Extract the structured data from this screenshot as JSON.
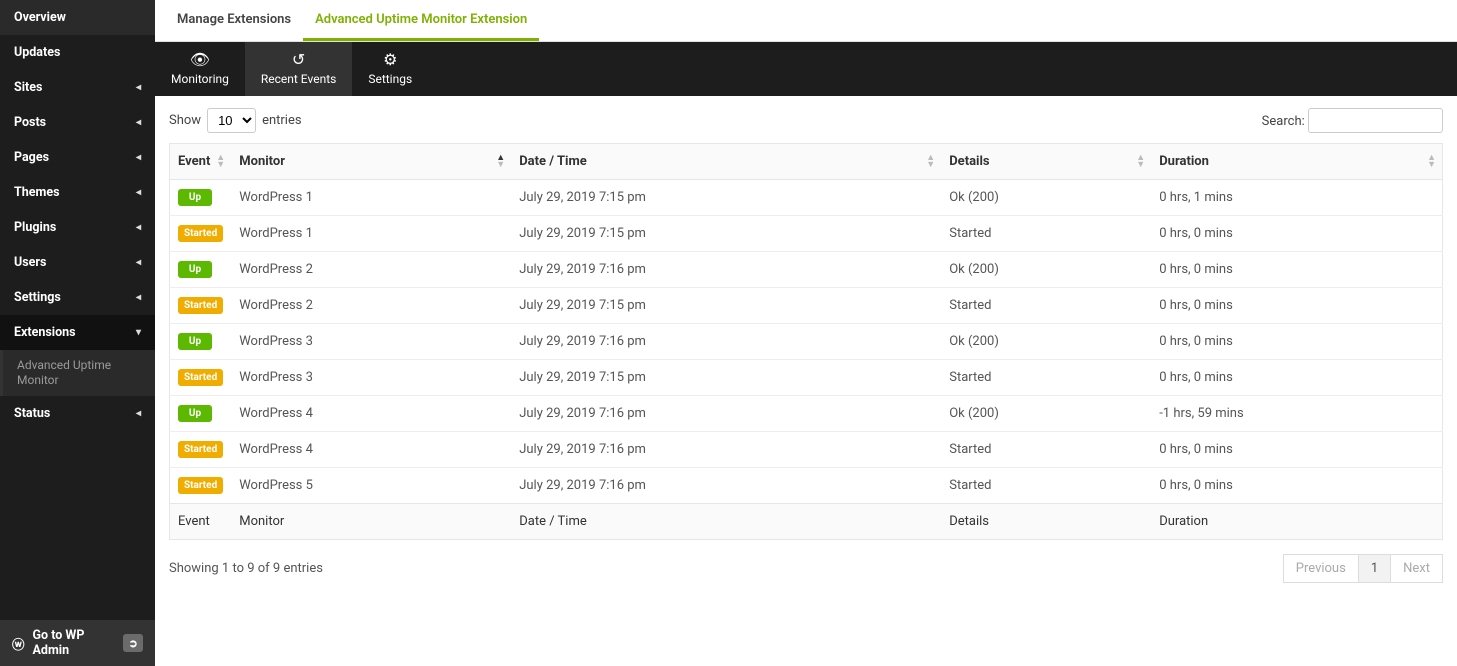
{
  "sidebar": {
    "items": [
      {
        "label": "Overview",
        "caret": false
      },
      {
        "label": "Updates",
        "caret": false
      },
      {
        "label": "Sites",
        "caret": true
      },
      {
        "label": "Posts",
        "caret": true
      },
      {
        "label": "Pages",
        "caret": true
      },
      {
        "label": "Themes",
        "caret": true
      },
      {
        "label": "Plugins",
        "caret": true
      },
      {
        "label": "Users",
        "caret": true
      },
      {
        "label": "Settings",
        "caret": true
      }
    ],
    "extensions": {
      "label": "Extensions",
      "sub": "Advanced Uptime Monitor"
    },
    "status": {
      "label": "Status"
    },
    "footer": {
      "label": "Go to WP Admin"
    }
  },
  "tabs": [
    {
      "label": "Manage Extensions",
      "active": false
    },
    {
      "label": "Advanced Uptime Monitor Extension",
      "active": true
    }
  ],
  "blacknav": [
    {
      "label": "Monitoring",
      "active": false
    },
    {
      "label": "Recent Events",
      "active": true
    },
    {
      "label": "Settings",
      "active": false
    }
  ],
  "table": {
    "show_prefix": "Show",
    "show_value": "10",
    "show_suffix": "entries",
    "search_label": "Search:",
    "headers": {
      "event": "Event",
      "monitor": "Monitor",
      "datetime": "Date / Time",
      "details": "Details",
      "duration": "Duration"
    },
    "rows": [
      {
        "event": "Up",
        "etype": "up",
        "monitor": "WordPress 1",
        "datetime": "July 29, 2019 7:15 pm",
        "details": "Ok (200)",
        "duration": "0 hrs, 1 mins"
      },
      {
        "event": "Started",
        "etype": "started",
        "monitor": "WordPress 1",
        "datetime": "July 29, 2019 7:15 pm",
        "details": "Started",
        "duration": "0 hrs, 0 mins"
      },
      {
        "event": "Up",
        "etype": "up",
        "monitor": "WordPress 2",
        "datetime": "July 29, 2019 7:16 pm",
        "details": "Ok (200)",
        "duration": "0 hrs, 0 mins"
      },
      {
        "event": "Started",
        "etype": "started",
        "monitor": "WordPress 2",
        "datetime": "July 29, 2019 7:15 pm",
        "details": "Started",
        "duration": "0 hrs, 0 mins"
      },
      {
        "event": "Up",
        "etype": "up",
        "monitor": "WordPress 3",
        "datetime": "July 29, 2019 7:16 pm",
        "details": "Ok (200)",
        "duration": "0 hrs, 0 mins"
      },
      {
        "event": "Started",
        "etype": "started",
        "monitor": "WordPress 3",
        "datetime": "July 29, 2019 7:15 pm",
        "details": "Started",
        "duration": "0 hrs, 0 mins"
      },
      {
        "event": "Up",
        "etype": "up",
        "monitor": "WordPress 4",
        "datetime": "July 29, 2019 7:16 pm",
        "details": "Ok (200)",
        "duration": "-1 hrs, 59 mins"
      },
      {
        "event": "Started",
        "etype": "started",
        "monitor": "WordPress 4",
        "datetime": "July 29, 2019 7:16 pm",
        "details": "Started",
        "duration": "0 hrs, 0 mins"
      },
      {
        "event": "Started",
        "etype": "started",
        "monitor": "WordPress 5",
        "datetime": "July 29, 2019 7:16 pm",
        "details": "Started",
        "duration": "0 hrs, 0 mins"
      }
    ],
    "info": "Showing 1 to 9 of 9 entries",
    "pager": {
      "prev": "Previous",
      "page": "1",
      "next": "Next"
    }
  }
}
